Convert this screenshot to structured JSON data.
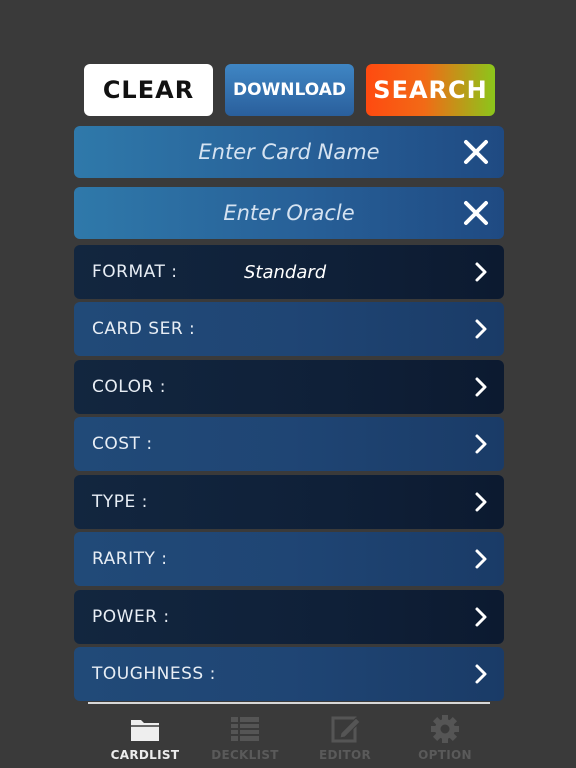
{
  "toolbar": {
    "clear_label": "CLEAR",
    "download_label": "DOWNLOAD",
    "search_label": "SEARCH"
  },
  "card_name": {
    "placeholder": "Enter Card Name",
    "value": ""
  },
  "oracle": {
    "placeholder": "Enter Oracle",
    "value": ""
  },
  "filters": [
    {
      "label": "FORMAT :",
      "value": "Standard"
    },
    {
      "label": "CARD SER :",
      "value": ""
    },
    {
      "label": "COLOR :",
      "value": ""
    },
    {
      "label": "COST :",
      "value": ""
    },
    {
      "label": "TYPE :",
      "value": ""
    },
    {
      "label": "RARITY :",
      "value": ""
    },
    {
      "label": "POWER :",
      "value": ""
    },
    {
      "label": "TOUGHNESS :",
      "value": ""
    }
  ],
  "tabs": [
    {
      "label": "CARDLIST",
      "icon": "folder-icon",
      "active": true
    },
    {
      "label": "DECKLIST",
      "icon": "list-icon",
      "active": false
    },
    {
      "label": "EDITOR",
      "icon": "edit-icon",
      "active": false
    },
    {
      "label": "OPTION",
      "icon": "gear-icon",
      "active": false
    }
  ],
  "colors": {
    "background": "#3a3a3a",
    "search_gradient_start": "#ff4a10",
    "search_gradient_end": "#8bc61b",
    "download": "#2a5f9c",
    "row_dark": "#0f2038",
    "row_blue": "#1f4574"
  }
}
